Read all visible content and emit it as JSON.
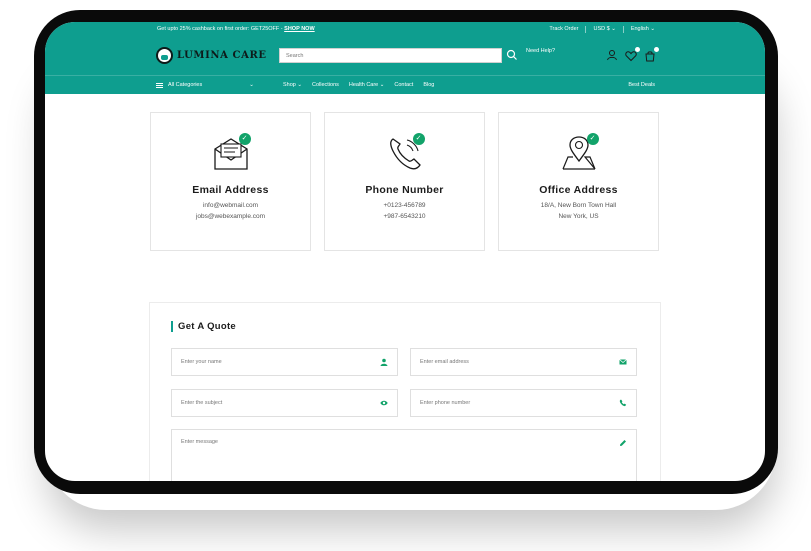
{
  "topbar": {
    "promo_text": "Get upto 25% cashback on first order: GET25OFF - ",
    "promo_link": "SHOP NOW",
    "track_order": "Track Order",
    "currency": "USD $ ⌄",
    "language": "English ⌄"
  },
  "header": {
    "logo_text": "LUMINA CARE",
    "search_placeholder": "Search",
    "need_help": "Need Help?"
  },
  "nav": {
    "all_categories": "All Categories",
    "links": [
      "Shop ⌄",
      "Collections",
      "Health Care ⌄",
      "Contact",
      "Blog"
    ],
    "best_deals": "Best Deals"
  },
  "contact_cards": [
    {
      "title": "Email Address",
      "lines": [
        "info@webmail.com",
        "jobs@webexample.com"
      ],
      "icon": "envelope-icon"
    },
    {
      "title": "Phone Number",
      "lines": [
        "+0123-456789",
        "+987-6543210"
      ],
      "icon": "phone-icon"
    },
    {
      "title": "Office Address",
      "lines": [
        "18/A, New Born Town Hall",
        "New York, US"
      ],
      "icon": "map-pin-icon"
    }
  ],
  "quote": {
    "title": "Get A Quote",
    "fields": {
      "name": "Enter your name",
      "email": "Enter email address",
      "subject": "Enter the subject",
      "phone": "Enter phone number",
      "message": "Enter message"
    }
  },
  "colors": {
    "brand": "#0e9e8f",
    "success": "#12a36a",
    "frame": "#0a0a0a"
  }
}
